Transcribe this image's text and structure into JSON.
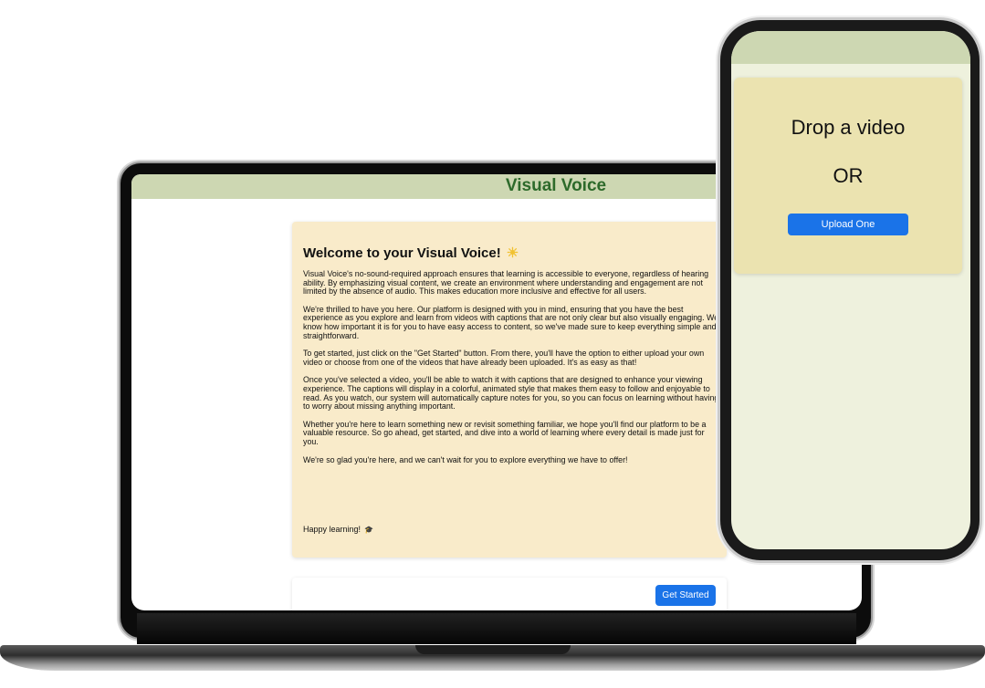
{
  "app": {
    "title": "Visual Voice"
  },
  "welcome": {
    "heading": "Welcome to your Visual Voice!",
    "heading_icon": "sun-icon",
    "paragraphs": [
      "Visual Voice's no-sound-required approach ensures that learning is accessible to everyone, regardless of hearing ability. By emphasizing visual content, we create an environment where understanding and engagement are not limited by the absence of audio. This makes education more inclusive and effective for all users.",
      "We're thrilled to have you here. Our platform is designed with you in mind, ensuring that you have the best experience as you explore and learn from videos with captions that are not only clear but also visually engaging. We know how important it is for you to have easy access to content, so we've made sure to keep everything simple and straightforward.",
      "To get started, just click on the \"Get Started\" button. From there, you'll have the option to either upload your own video or choose from one of the videos that have already been uploaded. It's as easy as that!",
      "Once you've selected a video, you'll be able to watch it with captions that are designed to enhance your viewing experience. The captions will display in a colorful, animated style that makes them easy to follow and enjoyable to read. As you watch, our system will automatically capture notes for you, so you can focus on learning without having to worry about missing anything important.",
      "Whether you're here to learn something new or revisit something familiar, we hope you'll find our platform to be a valuable resource. So go ahead, get started, and dive into a world of learning where every detail is made just for you.",
      "We're so glad you're here, and we can't wait for you to explore everything we have to offer!"
    ],
    "sign_off": "Happy learning!",
    "sign_off_icon": "graduation-cap-icon"
  },
  "actions": {
    "get_started_label": "Get Started"
  },
  "phone": {
    "drop_text": "Drop a video",
    "or_text": "OR",
    "upload_label": "Upload One"
  },
  "colors": {
    "header": "#cdd7b2",
    "title": "#2d6a2b",
    "card": "#f9ebca",
    "upload_card": "#ebe3b0",
    "button": "#1a73e8",
    "phone_bg": "#eef1dd"
  }
}
